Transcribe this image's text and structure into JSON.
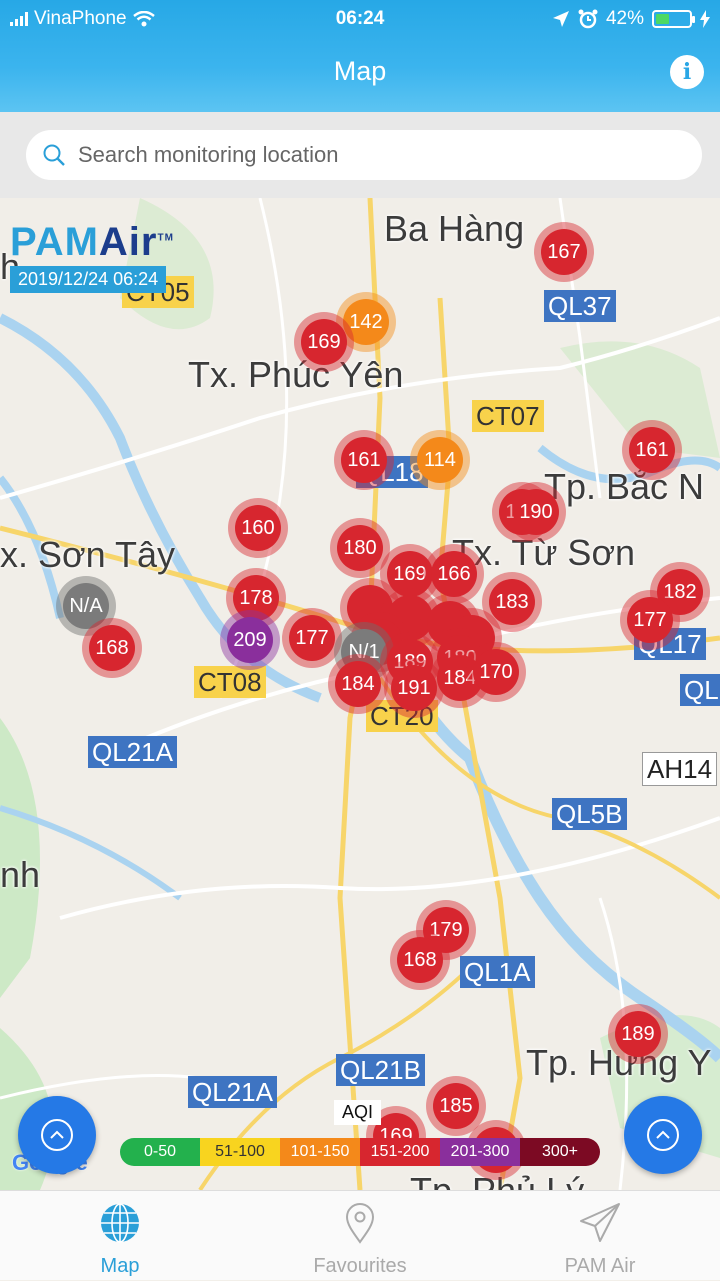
{
  "status_bar": {
    "carrier": "VinaPhone",
    "time": "06:24",
    "battery": "42%",
    "battery_level": 0.42
  },
  "header": {
    "title": "Map",
    "info_icon": "info-icon"
  },
  "search": {
    "placeholder": "Search monitoring location",
    "icon": "search-icon"
  },
  "map": {
    "logo": {
      "pam": "PAM",
      "air": "Air",
      "tm": "TM"
    },
    "timestamp": "2019/12/24 06:24",
    "places": {
      "ba_hang": "Ba Hàng",
      "phuc_yen": "Tx. Phúc Yên",
      "son_tay": "x. Sơn Tây",
      "tu_son": "Tx. Từ Sơn",
      "bac_ninh": "Tp. Bắc N",
      "hung_yen": "Tp. Hưng Y",
      "nh": "nh",
      "h": "h",
      "phu_ly": "Tp. Phủ Lý"
    },
    "roads": {
      "ql37": "QL37",
      "ct05": "CT05",
      "ct07": "CT07",
      "ql18": "QL18",
      "ql17": "QL17",
      "ql_edge": "QL",
      "ct08": "CT08",
      "ct20": "CT20",
      "ql21a_top": "QL21A",
      "ah14": "AH14",
      "ql5b": "QL5B",
      "ql1a": "QL1A",
      "ql21b": "QL21B",
      "ql21a_bottom": "QL21A"
    },
    "markers": {
      "m167": "167",
      "m142": "142",
      "m169a": "169",
      "m161a": "161",
      "m114": "114",
      "m161b": "161",
      "m190": "190",
      "m160": "160",
      "m180": "180",
      "m169b": "169",
      "m166": "166",
      "m183": "183",
      "m182": "182",
      "m177a": "177",
      "mna1": "N/A",
      "m168a": "168",
      "m178": "178",
      "m209": "209",
      "m177b": "177",
      "mna2": "N/1",
      "m189": "189",
      "m180b": "180",
      "m184a": "184",
      "m191": "191",
      "m184b": "184",
      "m170": "170",
      "m179": "179",
      "m168b": "168",
      "m189b": "189",
      "m185": "185",
      "m169c": "169"
    },
    "legend": {
      "title": "AQI",
      "ranges": [
        "0-50",
        "51-100",
        "101-150",
        "151-200",
        "201-300",
        "300+"
      ],
      "colors": [
        "#23b14d",
        "#f8d41f",
        "#f4891a",
        "#d7262f",
        "#8a2f9c",
        "#7c0a23"
      ]
    },
    "attribution": "Google"
  },
  "tabbar": {
    "tabs": [
      {
        "label": "Map",
        "icon": "globe-icon"
      },
      {
        "label": "Favourites",
        "icon": "location-pin-icon"
      },
      {
        "label": "PAM Air",
        "icon": "paper-plane-icon"
      }
    ]
  }
}
